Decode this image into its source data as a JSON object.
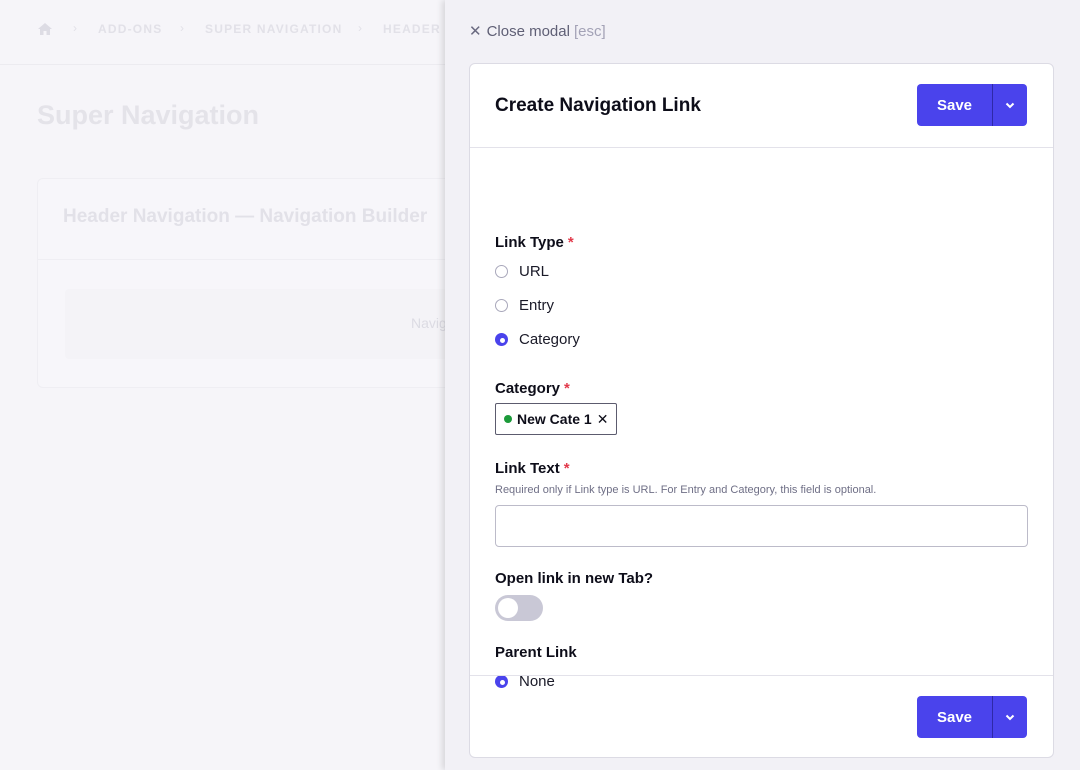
{
  "background": {
    "breadcrumb": [
      "ADD-ONS",
      "SUPER NAVIGATION",
      "HEADER N"
    ],
    "page_title": "Super Navigation",
    "panel_title": "Header Navigation — Navigation Builder",
    "panel_inner_text": "Navig"
  },
  "modal": {
    "close_label": "Close modal",
    "close_hint": "[esc]",
    "title": "Create Navigation Link",
    "save_label": "Save",
    "link_type": {
      "label": "Link Type",
      "options": [
        "URL",
        "Entry",
        "Category"
      ],
      "selected": "Category"
    },
    "category": {
      "label": "Category",
      "selected_tag": "New Cate 1",
      "tag_dot_color": "#1c9a3a"
    },
    "link_text": {
      "label": "Link Text",
      "help": "Required only if Link type is URL. For Entry and Category, this field is optional.",
      "value": ""
    },
    "new_tab": {
      "label": "Open link in new Tab?",
      "enabled": false
    },
    "parent_link": {
      "label": "Parent Link",
      "options": [
        "None"
      ],
      "selected": "None"
    }
  },
  "colors": {
    "accent": "#4a43ec",
    "required": "#e23a4b"
  }
}
